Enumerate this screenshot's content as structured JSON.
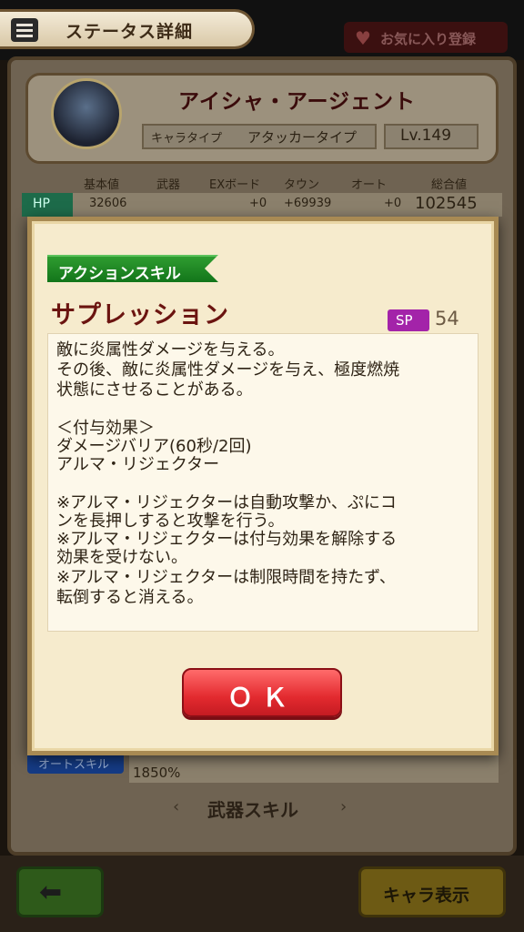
{
  "header": {
    "title": "ステータス詳細",
    "favorite_label": "お気に入り登録"
  },
  "character": {
    "name": "アイシャ・アージェント",
    "type_label": "キャラタイプ",
    "type_value": "アタッカータイプ",
    "level": "Lv.149"
  },
  "stats": {
    "headers": [
      "基本値",
      "武器",
      "EXボード",
      "タウン",
      "オート",
      "総合値"
    ],
    "hp": {
      "label": "HP",
      "values": [
        "32606",
        "",
        "+0",
        "+69939",
        "+0",
        "102545"
      ]
    }
  },
  "auto_skill": {
    "label": "オートスキル",
    "text": "1850%"
  },
  "weapon_skill_label": "武器スキル",
  "footer": {
    "chara_button": "キャラ表示"
  },
  "modal": {
    "skill_type": "アクションスキル",
    "skill_name": "サプレッション",
    "sp_label": "SP",
    "sp_value": "54",
    "description": [
      "敵に炎属性ダメージを与える。",
      "その後、敵に炎属性ダメージを与え、極度燃焼",
      "状態にさせることがある。",
      "",
      "＜付与効果＞",
      "ダメージバリア(60秒/2回)",
      "アルマ・リジェクター",
      "",
      "※アルマ・リジェクターは自動攻撃か、ぷにコ",
      "ンを長押しすると攻撃を行う。",
      "※アルマ・リジェクターは付与効果を解除する",
      "効果を受けない。",
      "※アルマ・リジェクターは制限時間を持たず、",
      "転倒すると消える。"
    ],
    "ok_label": "ＯＫ"
  }
}
